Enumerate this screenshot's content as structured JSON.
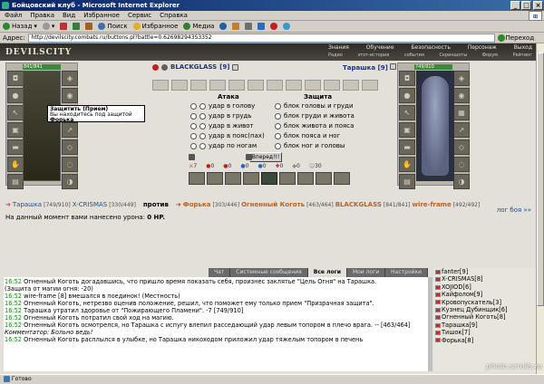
{
  "window": {
    "title": "Бойцовский клуб - Microsoft Internet Explorer"
  },
  "menu": [
    "Файл",
    "Правка",
    "Вид",
    "Избранное",
    "Сервис",
    "Справка"
  ],
  "toolbar": {
    "back": "Назад",
    "search": "Поиск",
    "favorites": "Избранное",
    "media": "Медиа"
  },
  "address": {
    "label": "Адрес:",
    "url": "http://devilscity.combats.ru/buttons.pl?battle=0.626982943S3352",
    "go": "Переход"
  },
  "game": {
    "logo": "DEVILSCITY",
    "nav": {
      "row1": [
        "Знания",
        "Обучение",
        "Безопасность",
        "Персонаж",
        "Выход"
      ],
      "row2": [
        "Радио",
        "этот-история",
        "события",
        "Скриншоты",
        "Форум",
        "Рейтинг"
      ]
    },
    "left_hp": "841/841",
    "right_hp": "749/910",
    "player1": {
      "name": "BLACKGLASS",
      "level": "[9]"
    },
    "player2": {
      "name": "Тарашка",
      "level": "[9]"
    },
    "tooltip": {
      "line1": "Защитить (Прием)",
      "line2": "Вы находитесь под защитой",
      "line3": "Форька"
    },
    "attack_header": "Атака",
    "defense_header": "Защита",
    "attacks": [
      "удар в голову",
      "удар в грудь",
      "удар в живот",
      "удар в пояс(пах)",
      "удар по ногам"
    ],
    "defenses": [
      "блок головы и груди",
      "блок груди и живота",
      "блок живота и пояса",
      "блок пояса и ног",
      "блок ног и головы"
    ],
    "fight_button": "Вперед!!!",
    "stats": [
      "7",
      "0",
      "0",
      "0",
      "0",
      "0",
      "0",
      "30"
    ],
    "vs": {
      "left": [
        {
          "name": "Тарашка",
          "hp": "[749/910]"
        },
        {
          "name": "X-CRISMAS",
          "hp": "[330/449]"
        }
      ],
      "word": "против",
      "right": [
        {
          "name": "Форька",
          "hp": "[303/446]"
        },
        {
          "name": "Огненный Коготь",
          "hp": "[463/464]"
        },
        {
          "name": "BLACKGLASS",
          "hp": "[841/841]"
        },
        {
          "name": "wire-frame",
          "hp": "[492/492]"
        }
      ],
      "more": "лог боя »»"
    },
    "damage_text": "На данный момент вами нанесено урона:",
    "damage_value": "0 HP."
  },
  "chat": {
    "tabs": [
      "Чат",
      "Системные сообщения",
      "Все логи",
      "Мои логи",
      "Настройки"
    ],
    "lines": [
      {
        "time": "16:52",
        "text": "Огненный Коготь догадавшись, что пришло время показать себя, произнес заклятье \"Цель Огня\" на Тарашка."
      },
      {
        "time": "",
        "text": "(Защита от магии огня: -20)"
      },
      {
        "time": "16:52",
        "text": "wire-frame [8] вмешался в поединок! (Местность)"
      },
      {
        "time": "16:52",
        "text": "Огненный Коготь, нетрезво оценив положение, решил, что поможет ему только прием \"Призрачная защита\"."
      },
      {
        "time": "16:52",
        "text": "Тарашка утратил здоровье от \"Пожирающего Пламени\". -7 [749/910]"
      },
      {
        "time": "16:52",
        "text": "Огненный Коготь потратил свой ход на магию."
      },
      {
        "time": "16:52",
        "text": "Огненный Коготь осмотрелся, но Тарашка с испугу влепил расседающий удар левым топором в плечо врага. -- [463/464]"
      },
      {
        "time": "",
        "text": "Комментатор: Больно ведь!"
      },
      {
        "time": "16:52",
        "text": "Огненный Коготь расплылся в улыбке, но Тарашка никоходом приложил удар тяжелым топором в печень"
      }
    ]
  },
  "users": [
    "fanter[9]",
    "X-CRISMAS[8]",
    "XOJIOD[6]",
    "Кайфолом[9]",
    "Кровопускатель[3]",
    "Кузнец Дубинщик[6]",
    "Огненный Коготь[8]",
    "Тарашка[9]",
    "Тишок[7]",
    "Форька[8]"
  ],
  "status": {
    "text": "Готово"
  },
  "watermark": "photo.scrolls.ru",
  "colors": {
    "titlebar": "#0a246a",
    "game_header": "#2e2c28",
    "name_blue": "#205090",
    "name_red": "#c02020",
    "time_green": "#208020"
  }
}
